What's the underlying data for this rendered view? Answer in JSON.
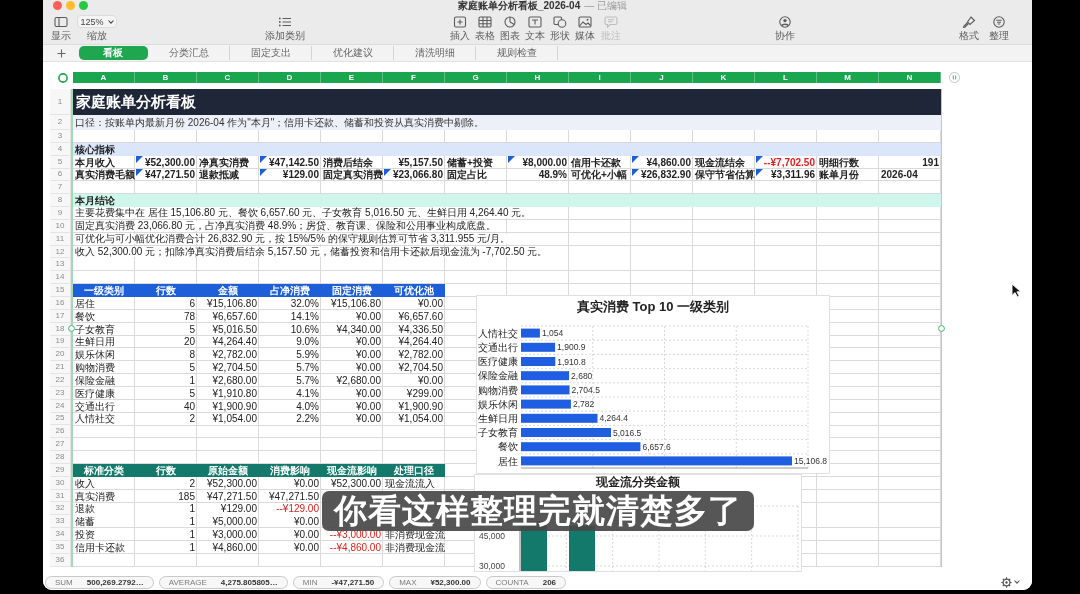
{
  "window": {
    "title": "家庭账单分析看板_2026-04",
    "status": "— 已编辑"
  },
  "toolbar": [
    [
      {
        "kind": "sidebar",
        "label": "显示",
        "disabled": false
      },
      {
        "kind": "zoom",
        "value": "125%",
        "label": "缩放",
        "disabled": false
      }
    ],
    [
      {
        "kind": "list",
        "label": "添加类别",
        "disabled": false
      }
    ],
    [
      {
        "kind": "insert",
        "label": "插入",
        "disabled": false
      },
      {
        "kind": "table",
        "label": "表格",
        "disabled": false
      },
      {
        "kind": "chart",
        "label": "图表",
        "disabled": false
      },
      {
        "kind": "text",
        "label": "文本",
        "disabled": false
      },
      {
        "kind": "shape",
        "label": "形状",
        "disabled": false
      },
      {
        "kind": "media",
        "label": "媒体",
        "disabled": false
      },
      {
        "kind": "comment",
        "label": "批注",
        "disabled": true
      }
    ],
    [
      {
        "kind": "collab",
        "label": "协作",
        "disabled": false
      }
    ],
    [
      {
        "kind": "format",
        "label": "格式",
        "disabled": false
      },
      {
        "kind": "organize",
        "label": "整理",
        "disabled": false
      }
    ]
  ],
  "tabs": [
    {
      "label": "看板",
      "selected": true
    },
    {
      "label": "分类汇总",
      "selected": false
    },
    {
      "label": "固定支出",
      "selected": false
    },
    {
      "label": "优化建议",
      "selected": false
    },
    {
      "label": "清洗明细",
      "selected": false
    },
    {
      "label": "规则检查",
      "selected": false
    }
  ],
  "sheet": {
    "columns": [
      "A",
      "B",
      "C",
      "D",
      "E",
      "F",
      "G",
      "H",
      "I",
      "J",
      "K",
      "L",
      "M",
      "N"
    ],
    "row_numbers": [
      "1",
      "2",
      "3",
      "4",
      "5",
      "6",
      "7",
      "8",
      "9",
      "10",
      "11",
      "12",
      "13",
      "14",
      "15",
      "16",
      "17",
      "18",
      "19",
      "20",
      "21",
      "22",
      "23",
      "24",
      "25",
      "26",
      "27",
      "28",
      "29",
      "30",
      "31",
      "32",
      "33",
      "34",
      "35",
      "36"
    ],
    "title": "家庭账单分析看板",
    "note": "口径：按账单内最新月份 2026-04 作为\"本月\"；信用卡还款、储蓄和投资从真实消费中剔除。",
    "metrics": {
      "heading": "核心指标",
      "rows": [
        [
          {
            "label": "本月收入",
            "value": "¥52,300.00",
            "kind": "number",
            "flagged": true
          },
          {
            "label": "净真实消费",
            "value": "¥47,142.50",
            "kind": "number",
            "flagged": true
          },
          {
            "label": "消费后结余",
            "value": "¥5,157.50",
            "kind": "number",
            "flagged": false
          },
          {
            "label": "储蓄+投资",
            "value": "¥8,000.00",
            "kind": "number",
            "flagged": true
          },
          {
            "label": "信用卡还款",
            "value": "¥4,860.00",
            "kind": "number",
            "flagged": true
          },
          {
            "label": "现金流结余",
            "value": "--¥7,702.50",
            "kind": "negative",
            "flagged": true
          },
          {
            "label": "明细行数",
            "value": "191",
            "kind": "number",
            "flagged": false
          }
        ],
        [
          {
            "label": "真实消费毛额",
            "value": "¥47,271.50",
            "kind": "number",
            "flagged": true
          },
          {
            "label": "退款抵减",
            "value": "¥129.00",
            "kind": "number",
            "flagged": true
          },
          {
            "label": "固定真实消费",
            "value": "¥23,066.80",
            "kind": "number",
            "flagged": true
          },
          {
            "label": "固定占比",
            "value": "48.9%",
            "kind": "number",
            "flagged": false
          },
          {
            "label": "可优化+小幅",
            "value": "¥26,832.90",
            "kind": "number",
            "flagged": true
          },
          {
            "label": "保守节省估算",
            "value": "¥3,311.96",
            "kind": "number",
            "flagged": true
          },
          {
            "label": "账单月份",
            "value": "2026-04",
            "kind": "text",
            "flagged": false
          }
        ]
      ]
    },
    "conclusion": {
      "heading": "本月结论",
      "lines": [
        "主要花费集中在 居住 15,106.80 元、餐饮 6,657.60 元、子女教育 5,016.50 元、生鲜日用 4,264.40 元。",
        "固定真实消费 23,066.80 元，占净真实消费 48.9%；房贷、教育课、保险和公用事业构成底盘。",
        "可优化与可小幅优化消费合计 26,832.90 元，按 15%/5% 的保守规则估算可节省 3,311.955 元/月。",
        "收入 52,300.00 元；扣除净真实消费后结余 5,157.50 元，储蓄投资和信用卡还款后现金流为 -7,702.50 元。"
      ]
    },
    "category_table": {
      "columns": [
        "一级类别",
        "行数",
        "金额",
        "占净消费",
        "固定消费",
        "可优化池"
      ],
      "rows": [
        [
          "居住",
          "6",
          "¥15,106.80",
          "32.0%",
          "¥15,106.80",
          "¥0.00"
        ],
        [
          "餐饮",
          "78",
          "¥6,657.60",
          "14.1%",
          "¥0.00",
          "¥6,657.60"
        ],
        [
          "子女教育",
          "5",
          "¥5,016.50",
          "10.6%",
          "¥4,340.00",
          "¥4,336.50"
        ],
        [
          "生鲜日用",
          "20",
          "¥4,264.40",
          "9.0%",
          "¥0.00",
          "¥4,264.40"
        ],
        [
          "娱乐休闲",
          "8",
          "¥2,782.00",
          "5.9%",
          "¥0.00",
          "¥2,782.00"
        ],
        [
          "购物消费",
          "5",
          "¥2,704.50",
          "5.7%",
          "¥0.00",
          "¥2,704.50"
        ],
        [
          "保险金融",
          "1",
          "¥2,680.00",
          "5.7%",
          "¥2,680.00",
          "¥0.00"
        ],
        [
          "医疗健康",
          "5",
          "¥1,910.80",
          "4.1%",
          "¥0.00",
          "¥299.00"
        ],
        [
          "交通出行",
          "40",
          "¥1,900.90",
          "4.0%",
          "¥0.00",
          "¥1,900.90"
        ],
        [
          "人情社交",
          "2",
          "¥1,054.00",
          "2.2%",
          "¥0.00",
          "¥1,054.00"
        ]
      ]
    },
    "flow_table": {
      "columns": [
        "标准分类",
        "行数",
        "原始金额",
        "消费影响",
        "现金流影响",
        "处理口径"
      ],
      "rows": [
        {
          "category": "收入",
          "count": "2",
          "original": "¥52,300.00",
          "consumption": "¥0.00",
          "consumption_negative": false,
          "cashflow": "¥52,300.00",
          "cashflow_negative": false,
          "rule": "现金流流入"
        },
        {
          "category": "真实消费",
          "count": "185",
          "original": "¥47,271.50",
          "consumption": "¥47,271.50",
          "consumption_negative": false
        },
        {
          "category": "退款",
          "count": "1",
          "original": "¥129.00",
          "consumption": "--¥129.00",
          "consumption_negative": true
        },
        {
          "category": "储蓄",
          "count": "1",
          "original": "¥5,000.00",
          "consumption": "¥0.00",
          "consumption_negative": false
        },
        {
          "category": "投资",
          "count": "1",
          "original": "¥3,000.00",
          "consumption": "¥0.00",
          "consumption_negative": false,
          "cashflow": "--¥3,000.00",
          "cashflow_negative": true,
          "rule": "非消费现金流"
        },
        {
          "category": "信用卡还款",
          "count": "1",
          "original": "¥4,860.00",
          "consumption": "¥0.00",
          "consumption_negative": false,
          "cashflow": "--¥4,860.00",
          "cashflow_negative": true,
          "rule": "非消费现金流"
        }
      ]
    }
  },
  "charts": [
    {
      "chart_data": {
        "type": "bar",
        "title": "真实消费 Top 10 一级类别",
        "orientation": "horizontal",
        "categories": [
          "人情社交",
          "交通出行",
          "医疗健康",
          "保险金融",
          "购物消费",
          "娱乐休闲",
          "生鲜日用",
          "子女教育",
          "餐饮",
          "居住"
        ],
        "values": [
          1054,
          1900.9,
          1910.8,
          2680,
          2704.5,
          2782,
          4264.4,
          5016.5,
          6657.6,
          15106.8
        ],
        "value_labels": [
          "1,054",
          "1,900.9",
          "1,910.8",
          "2,680",
          "2,704.5",
          "2,782",
          "4,264.4",
          "5,016.5",
          "6,657.6",
          "15,106.8"
        ]
      }
    },
    {
      "title": "现金流分类金额",
      "axis_labels": [
        "45,000",
        "30,000"
      ]
    }
  ],
  "subtitle": "你看这样整理完就清楚多了",
  "status_bar": [
    {
      "label": "SUM",
      "value": "500,269.2792…"
    },
    {
      "label": "AVERAGE",
      "value": "4,275.805805…"
    },
    {
      "label": "MIN",
      "value": "-¥47,271.50"
    },
    {
      "label": "MAX",
      "value": "¥52,300.00"
    },
    {
      "label": "COUNTA",
      "value": "206"
    }
  ]
}
